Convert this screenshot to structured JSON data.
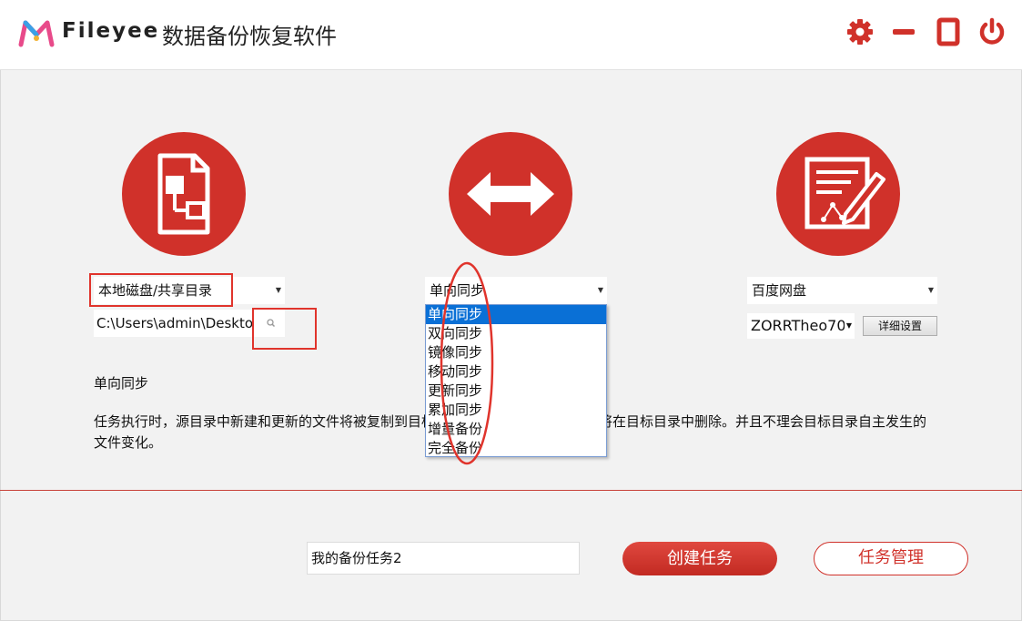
{
  "header": {
    "brand": "Fileyee",
    "app_title": "数据备份恢复软件",
    "buttons": [
      "gear-icon",
      "minimize-icon",
      "maximize-icon",
      "power-icon"
    ]
  },
  "colors": {
    "accent": "#d0312a",
    "selection": "#0a70d6"
  },
  "source": {
    "icon": "document-structure-icon",
    "type_selected": "本地磁盘/共享目录",
    "path_value": "C:\\Users\\admin\\Deskto"
  },
  "sync": {
    "icon": "double-arrow-icon",
    "mode_selected": "单向同步",
    "mode_options": [
      "单向同步",
      "双向同步",
      "镜像同步",
      "移动同步",
      "更新同步",
      "累加同步",
      "增量备份",
      "完全备份"
    ],
    "selected_index": 0
  },
  "target": {
    "icon": "edit-document-icon",
    "type_selected": "百度网盘",
    "account_value": "ZORRTheo70",
    "detail_button": "详细设置"
  },
  "description": {
    "title": "单向同步",
    "text": "任务执行时，源目录中新建和更新的文件将被复制到目标目录，源目录中删除的文件将在目标目录中删除。并且不理会目标目录自主发生的文件变化。"
  },
  "footer": {
    "task_name_value": "我的备份任务2",
    "create_button": "创建任务",
    "manage_button": "任务管理"
  }
}
